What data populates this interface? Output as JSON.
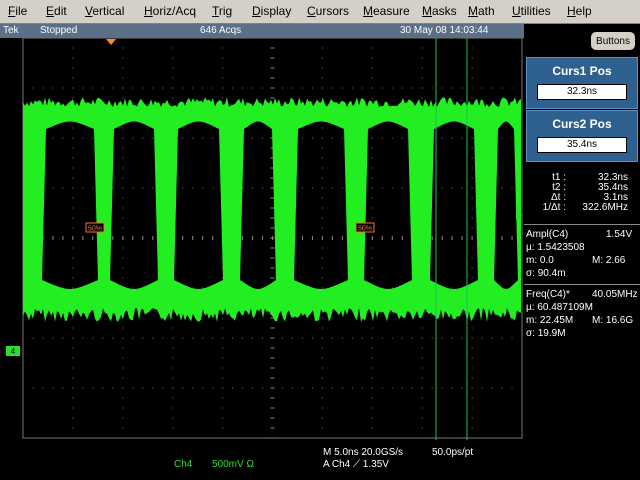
{
  "menu": [
    "File",
    "Edit",
    "Vertical",
    "Horiz/Acq",
    "Trig",
    "Display",
    "Cursors",
    "Measure",
    "Masks",
    "Math",
    "Utilities",
    "Help"
  ],
  "status": {
    "brand": "Tek",
    "state": "Stopped",
    "acqs": "646 Acqs",
    "datetime": "30 May 08 14:03:44"
  },
  "buttons_label": "Buttons",
  "cursor1": {
    "title": "Curs1 Pos",
    "value": "32.3ns"
  },
  "cursor2": {
    "title": "Curs2 Pos",
    "value": "35.4ns"
  },
  "cursor_readout": [
    {
      "label": "t1 :",
      "value": "32.3ns"
    },
    {
      "label": "t2 :",
      "value": "35.4ns"
    },
    {
      "label": "Δt :",
      "value": "3.1ns"
    },
    {
      "label": "1/Δt :",
      "value": "322.6MHz"
    }
  ],
  "ampl": {
    "title": "Ampl(C4)",
    "value": "1.54V",
    "mu": "µ: 1.5423508",
    "m": "m: 0.0",
    "M": "M: 2.66",
    "sigma": "σ: 90.4m"
  },
  "freq": {
    "title": "Freq(C4)*",
    "value": "40.05MHz",
    "mu": "µ: 60.487109M",
    "m": "m: 22.45M",
    "M": "M: 16.6G",
    "sigma": "σ: 19.9M"
  },
  "markers": {
    "ch4": "4",
    "pct_left": "50%",
    "pct_right": "50%"
  },
  "bottom": {
    "timebase": "M 5.0ns 20.0GS/s",
    "resolution": "50.0ps/pt",
    "trigger": "A  Ch4  ⟋ 1.35V",
    "channel": "Ch4",
    "volts": "500mV  Ω"
  },
  "colors": {
    "trace": "#22ee22",
    "cursor": "#1fbf5a",
    "panel": "#2e6190",
    "menubar": "#d4d0c8",
    "status": "#5b6f86"
  }
}
